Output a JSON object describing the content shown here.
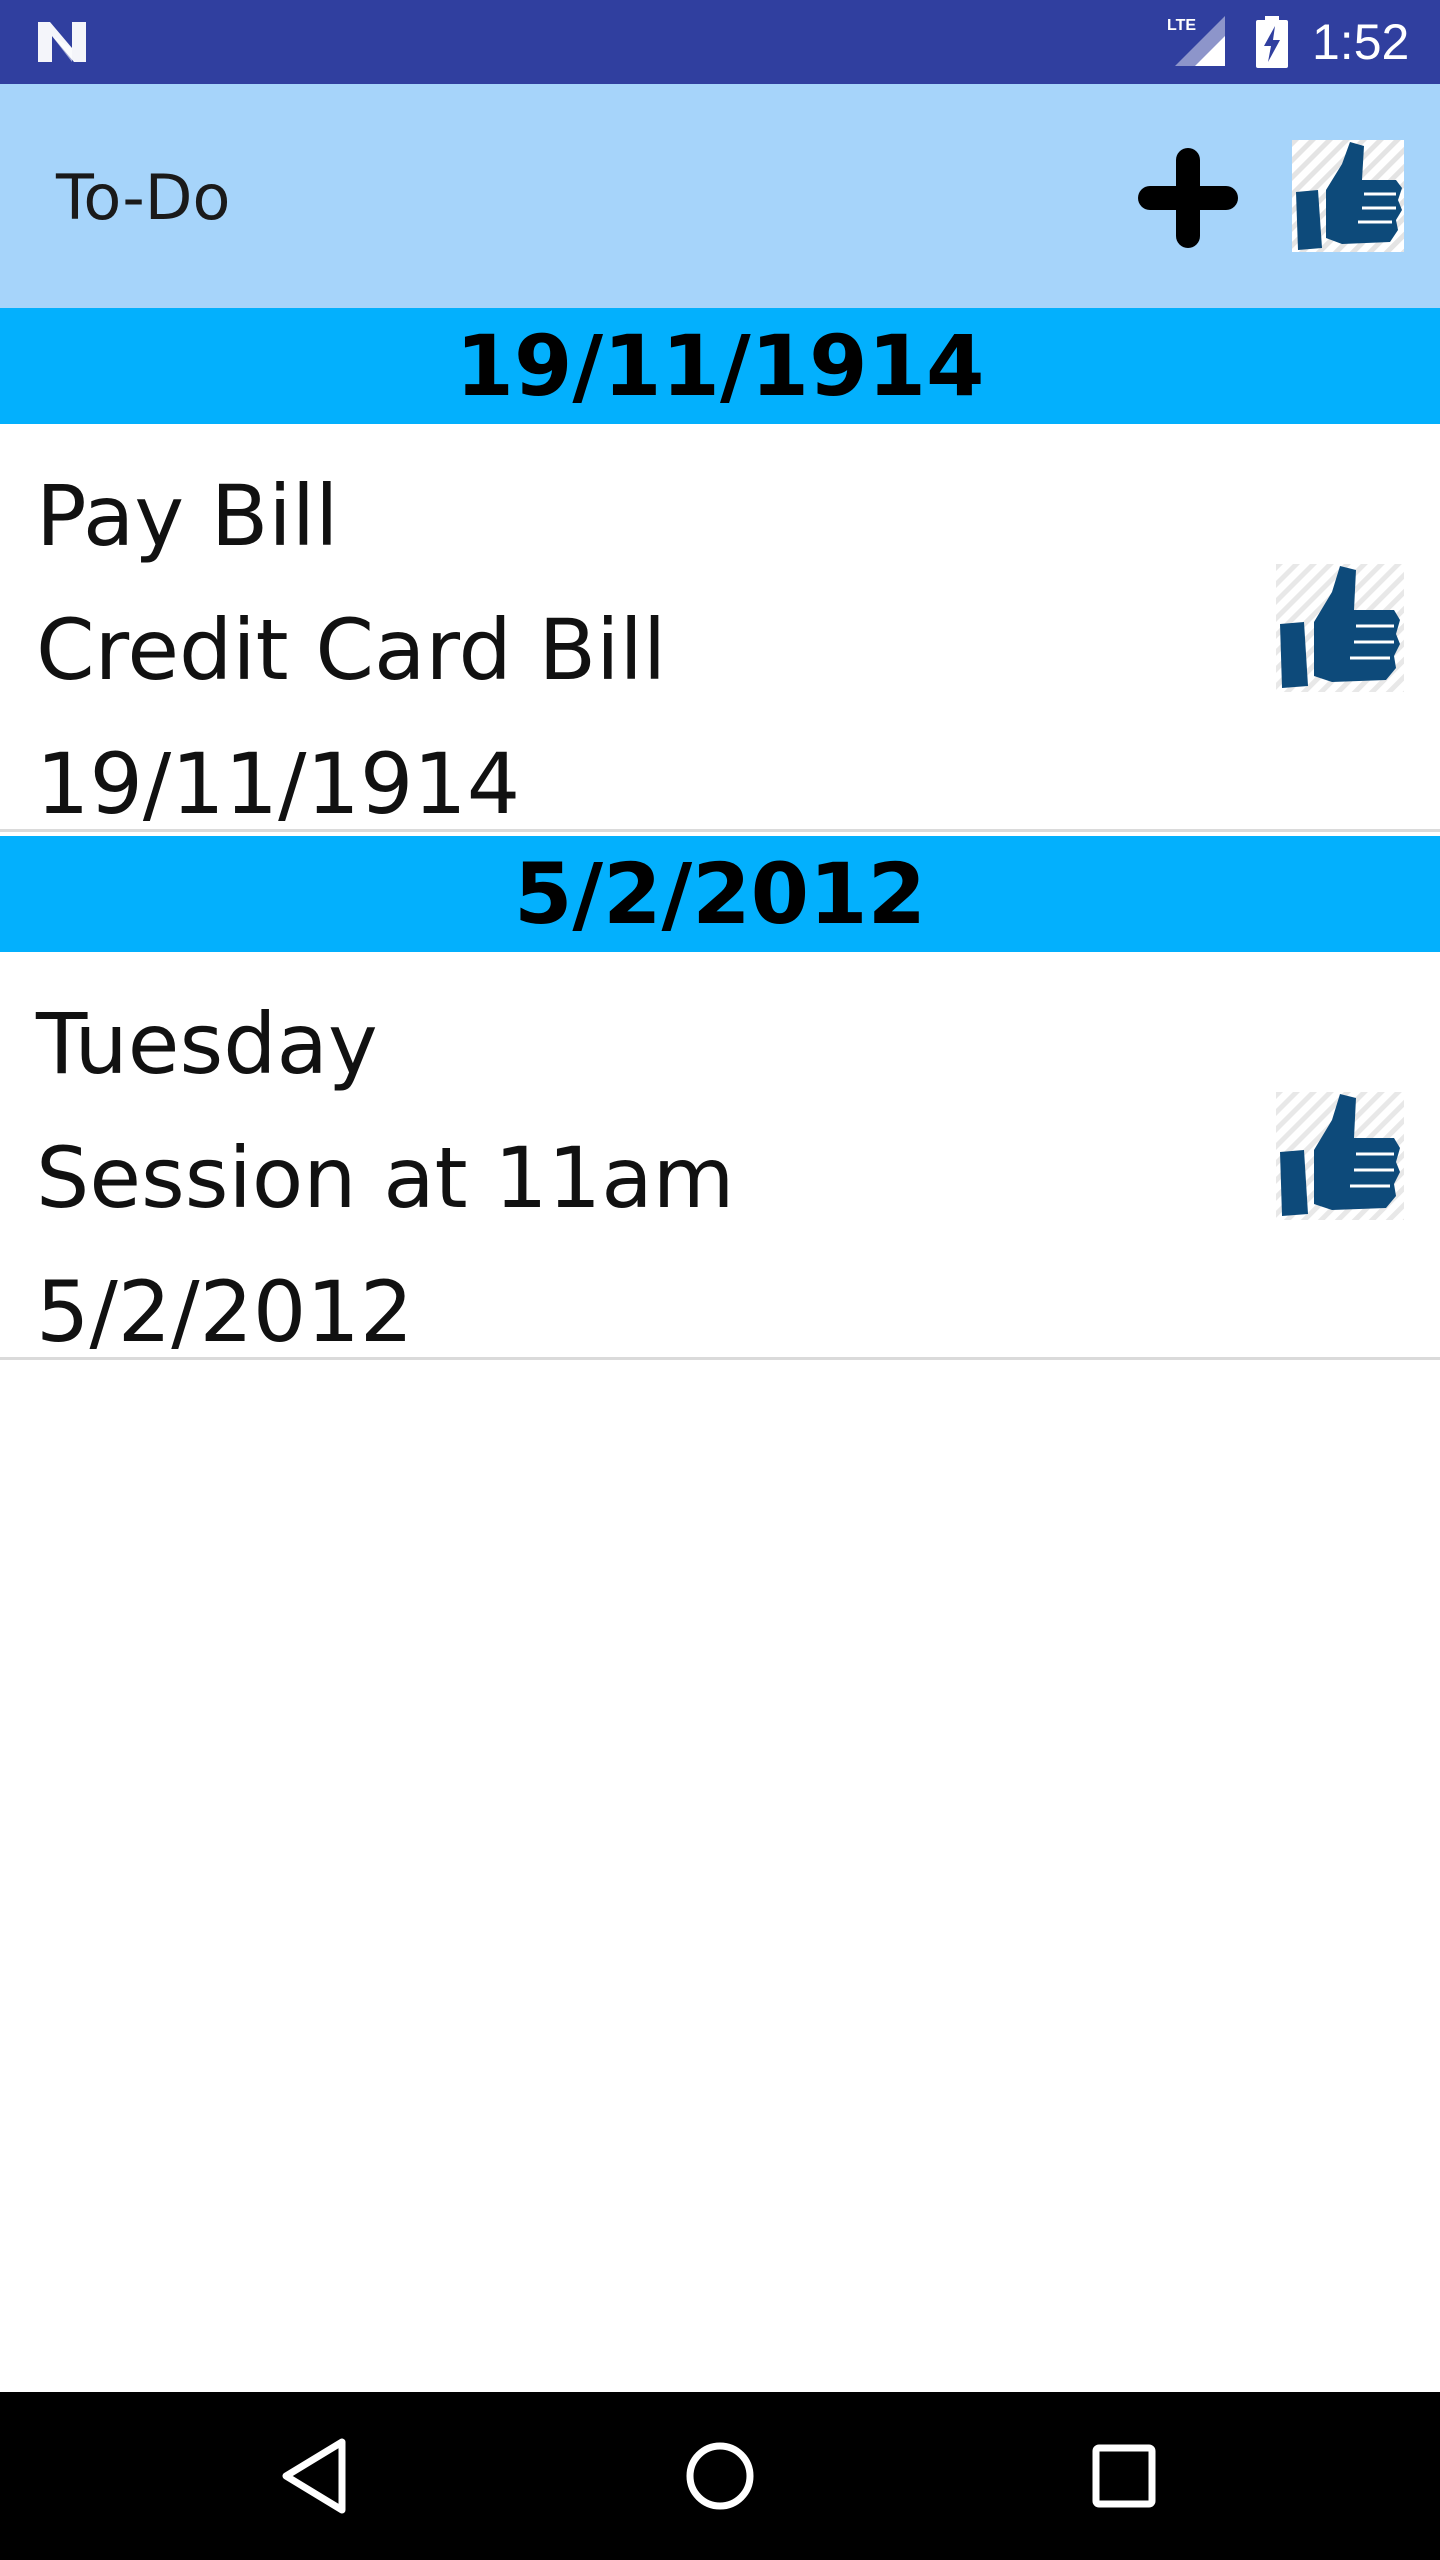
{
  "status_bar": {
    "network": "LTE",
    "time": "1:52"
  },
  "app_bar": {
    "title": "To-Do"
  },
  "groups": [
    {
      "header": "19/11/1914",
      "item": {
        "title": "Pay Bill",
        "description": "Credit Card Bill",
        "date": "19/11/1914"
      }
    },
    {
      "header": "5/2/2012",
      "item": {
        "title": "Tuesday",
        "description": "Session at 11am",
        "date": "5/2/2012"
      }
    }
  ],
  "colors": {
    "status_bar": "#303F9F",
    "app_bar": "#A6D4FA",
    "section_header": "#03B0FD",
    "thumb": "#0D4A7A"
  }
}
